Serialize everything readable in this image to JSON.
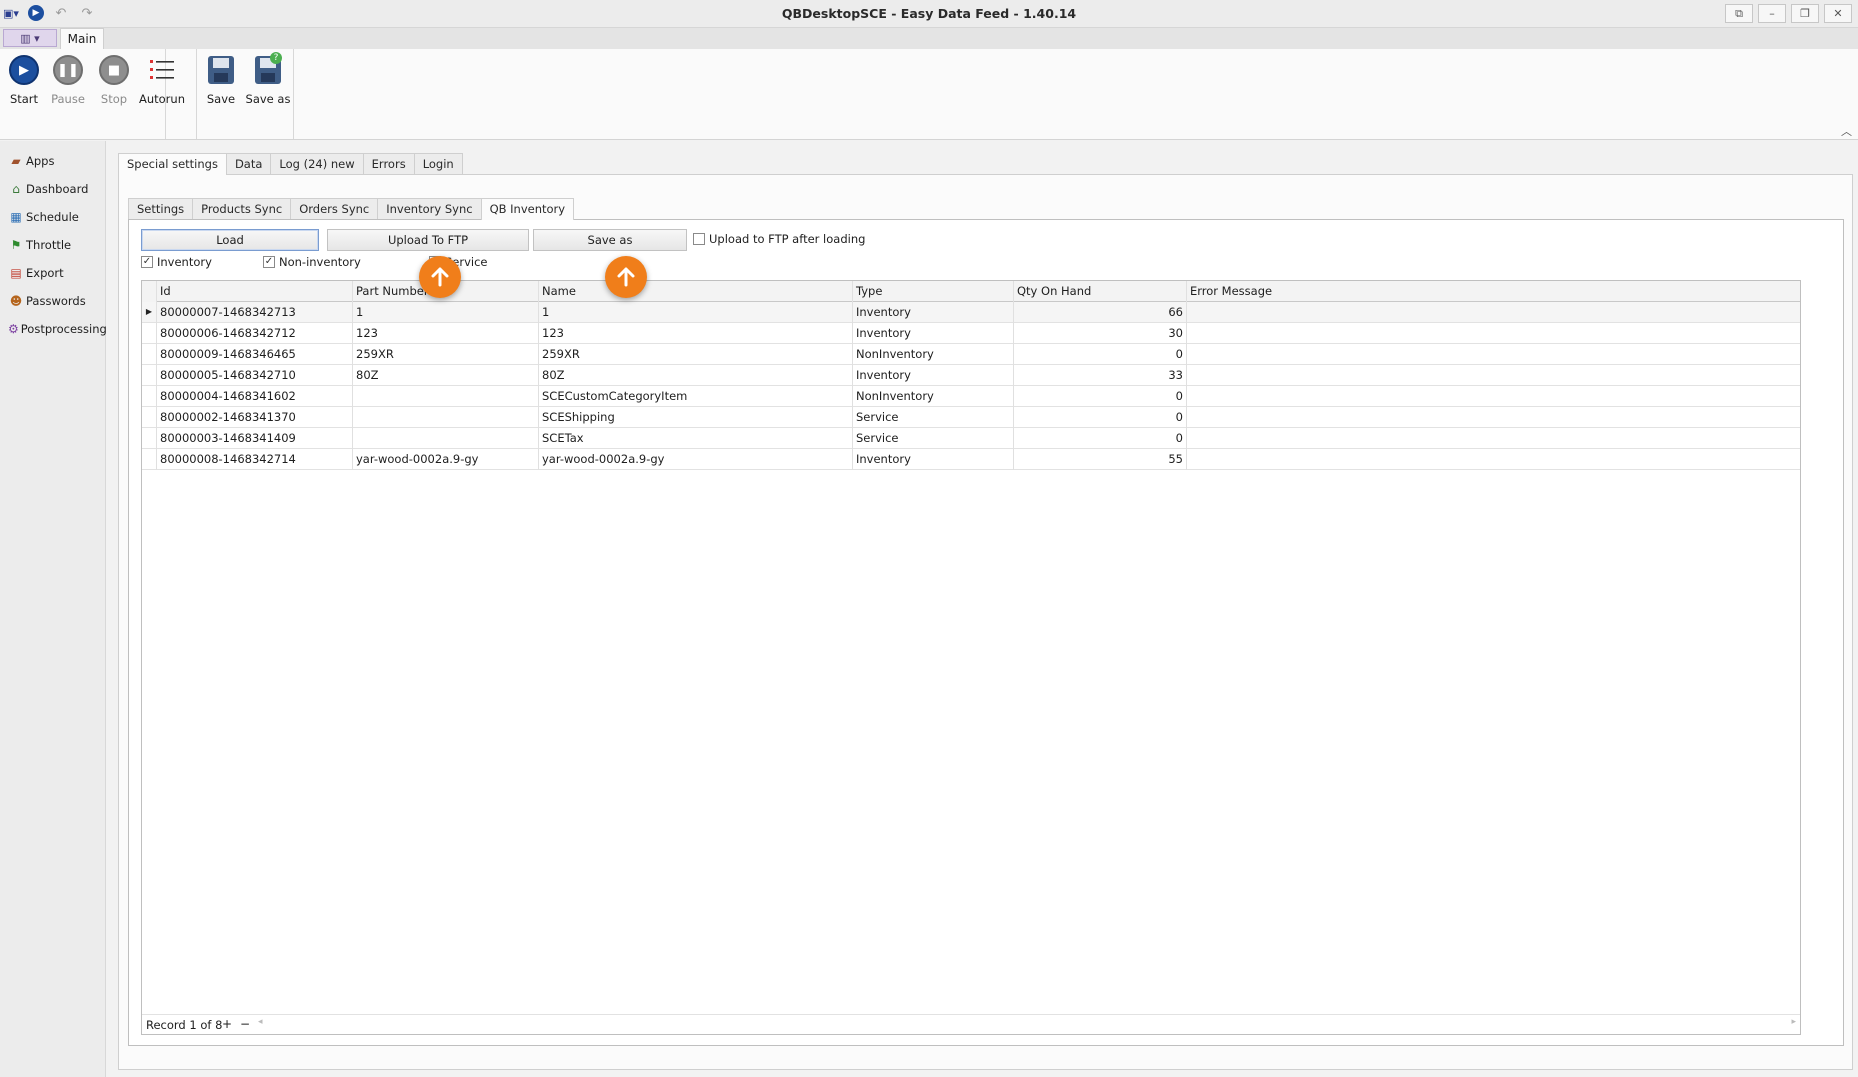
{
  "window": {
    "title": "QBDesktopSCE - Easy Data Feed - 1.40.14",
    "controls": [
      "restore-icon",
      "minimize-icon",
      "maximize-icon",
      "close-icon"
    ]
  },
  "ribbon": {
    "tab_main": "Main",
    "buttons": {
      "start": "Start",
      "pause": "Pause",
      "stop": "Stop",
      "autorun": "Autorun",
      "save": "Save",
      "save_as": "Save as"
    }
  },
  "sidebar": {
    "items": [
      {
        "label": "Apps",
        "icon": "briefcase-icon"
      },
      {
        "label": "Dashboard",
        "icon": "home-icon"
      },
      {
        "label": "Schedule",
        "icon": "calendar-icon"
      },
      {
        "label": "Throttle",
        "icon": "flag-icon"
      },
      {
        "label": "Export",
        "icon": "table-icon"
      },
      {
        "label": "Passwords",
        "icon": "users-icon"
      },
      {
        "label": "Postprocessing",
        "icon": "postprocessing-icon"
      }
    ]
  },
  "outer_tabs": [
    "Special settings",
    "Data",
    "Log (24) new",
    "Errors",
    "Login"
  ],
  "inner_tabs": [
    "Settings",
    "Products Sync",
    "Orders Sync",
    "Inventory Sync",
    "QB Inventory"
  ],
  "toolbar": {
    "load": "Load",
    "upload_ftp": "Upload To FTP",
    "save_as": "Save as",
    "upload_after_loading": "Upload to FTP after loading"
  },
  "filters": {
    "inventory": {
      "label": "Inventory",
      "checked": true
    },
    "non_inventory": {
      "label": "Non-inventory",
      "checked": true
    },
    "service": {
      "label": "Service",
      "checked": true
    }
  },
  "grid": {
    "columns": [
      "Id",
      "Part Number",
      "Name",
      "Type",
      "Qty On Hand",
      "Error Message"
    ],
    "rows": [
      {
        "id": "80000007-1468342713",
        "part": "1",
        "name": "1",
        "type": "Inventory",
        "qty": "66",
        "error": ""
      },
      {
        "id": "80000006-1468342712",
        "part": "123",
        "name": "123",
        "type": "Inventory",
        "qty": "30",
        "error": ""
      },
      {
        "id": "80000009-1468346465",
        "part": "259XR",
        "name": "259XR",
        "type": "NonInventory",
        "qty": "0",
        "error": ""
      },
      {
        "id": "80000005-1468342710",
        "part": "80Z",
        "name": "80Z",
        "type": "Inventory",
        "qty": "33",
        "error": ""
      },
      {
        "id": "80000004-1468341602",
        "part": "",
        "name": "SCECustomCategoryItem",
        "type": "NonInventory",
        "qty": "0",
        "error": ""
      },
      {
        "id": "80000002-1468341370",
        "part": "",
        "name": "SCEShipping",
        "type": "Service",
        "qty": "0",
        "error": ""
      },
      {
        "id": "80000003-1468341409",
        "part": "",
        "name": "SCETax",
        "type": "Service",
        "qty": "0",
        "error": ""
      },
      {
        "id": "80000008-1468342714",
        "part": "yar-wood-0002a.9-gy",
        "name": "yar-wood-0002a.9-gy",
        "type": "Inventory",
        "qty": "55",
        "error": ""
      }
    ],
    "record_label": "Record 1 of 8",
    "add": "+",
    "remove": "−"
  },
  "colors": {
    "callout": "#f07e1a",
    "accent_blue": "#1c4f9e"
  }
}
